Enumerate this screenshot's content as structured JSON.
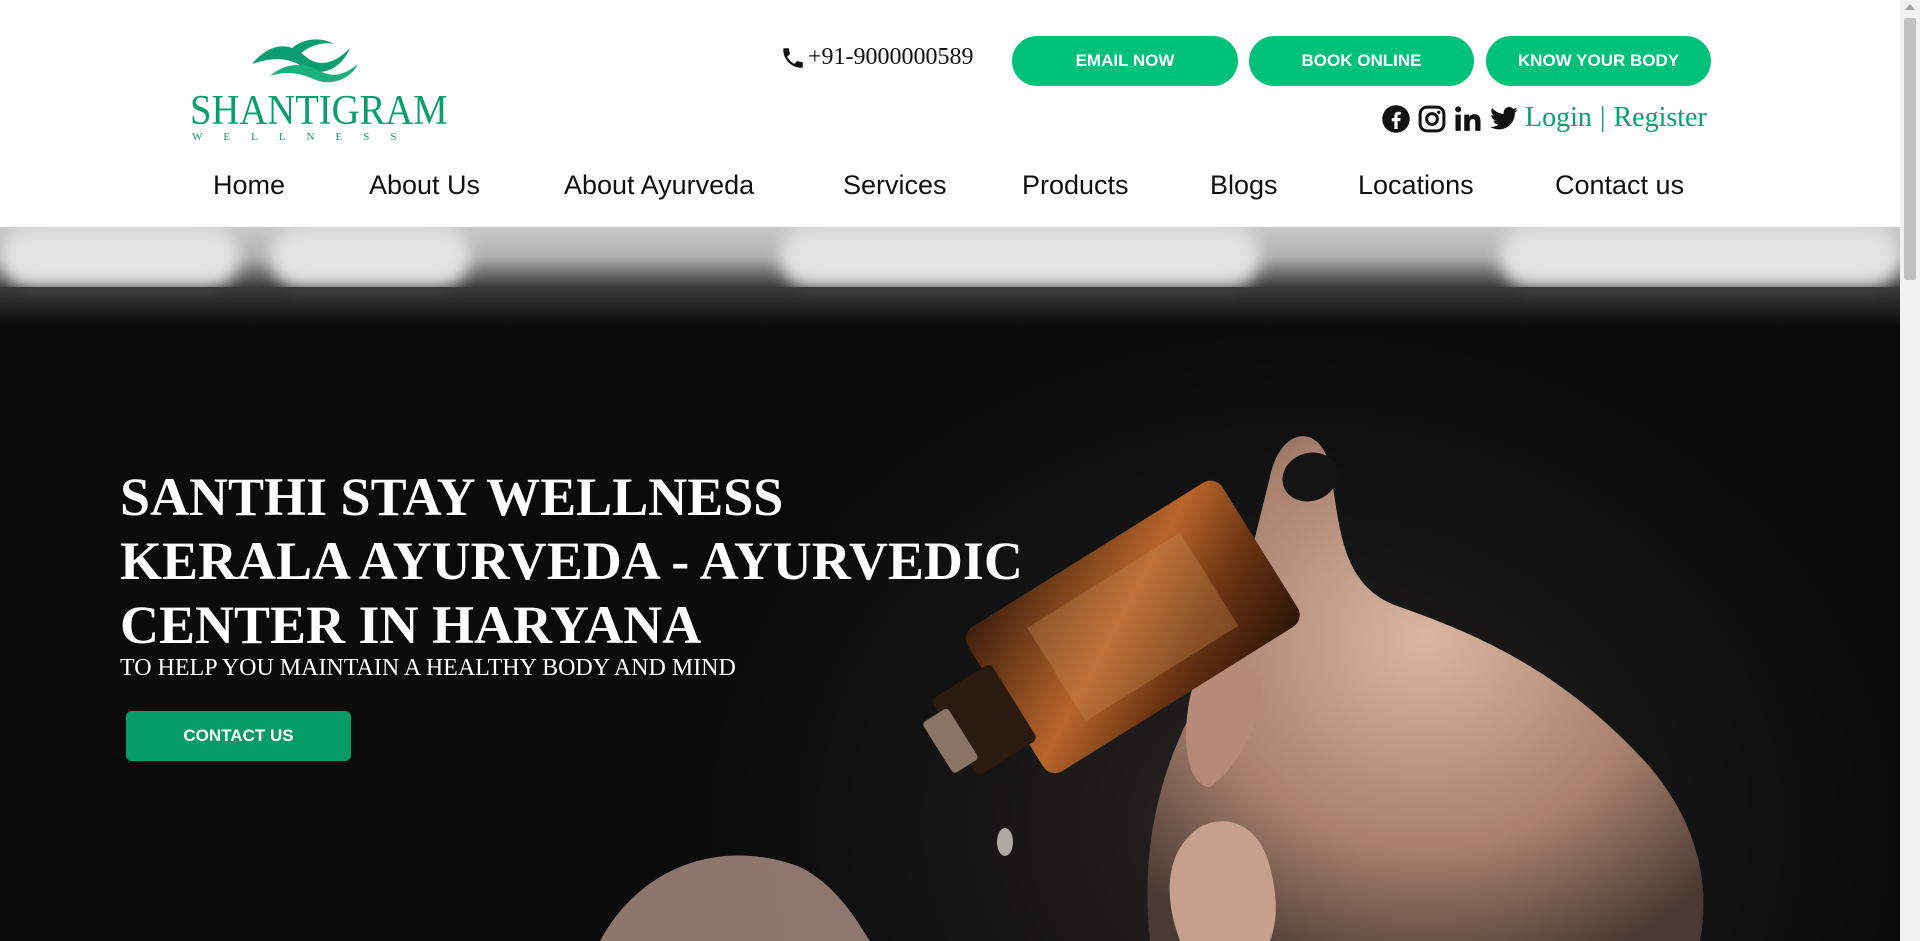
{
  "brand": {
    "name": "SHANTIGRAM",
    "tagline": "WELLNESS",
    "color": "#0a9e6e"
  },
  "header": {
    "phone": "+91-9000000589",
    "buttons": {
      "email": "EMAIL NOW",
      "book": "BOOK ONLINE",
      "know": "KNOW YOUR BODY"
    },
    "auth": {
      "login": "Login",
      "separator": "|",
      "register": "Register"
    },
    "social_icons": [
      "facebook-icon",
      "instagram-icon",
      "linkedin-icon",
      "twitter-icon"
    ]
  },
  "nav": {
    "items": [
      {
        "label": "Home"
      },
      {
        "label": "About Us"
      },
      {
        "label": "About Ayurveda"
      },
      {
        "label": "Services"
      },
      {
        "label": "Products"
      },
      {
        "label": "Blogs"
      },
      {
        "label": "Locations"
      },
      {
        "label": "Contact us"
      }
    ]
  },
  "hero": {
    "title_line1": "SANTHI STAY WELLNESS",
    "title_line2": "KERALA AYURVEDA - AYURVEDIC",
    "title_line3": "CENTER IN HARYANA",
    "subtitle": "TO HELP YOU MAINTAIN A HEALTHY BODY AND MIND",
    "cta": "CONTACT US"
  },
  "colors": {
    "accent": "#00c17a",
    "cta": "#059a66"
  }
}
